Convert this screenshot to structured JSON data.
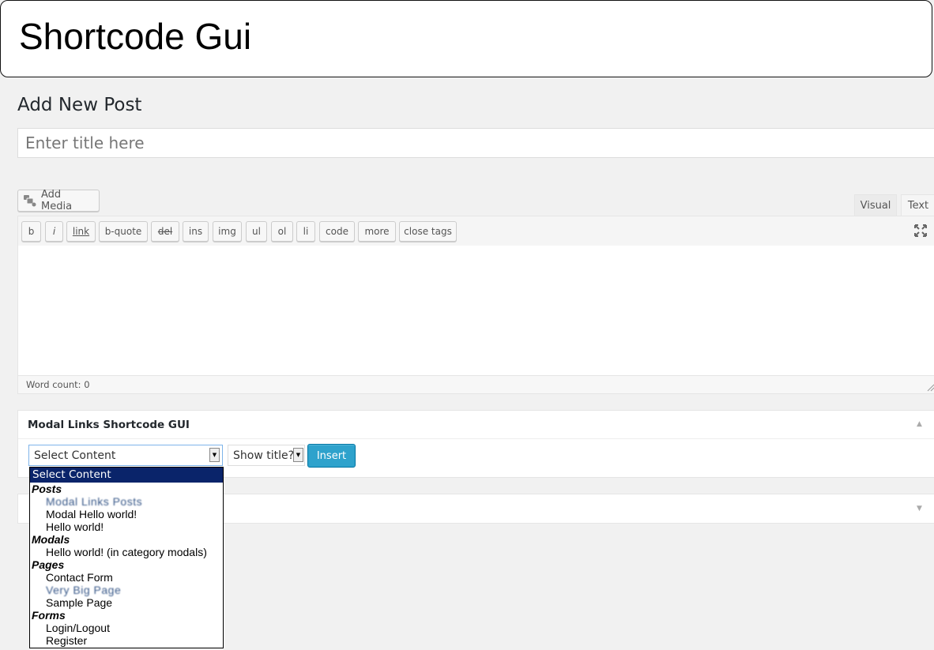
{
  "banner": {
    "title": "Shortcode Gui"
  },
  "page": {
    "heading": "Add New Post"
  },
  "title_field": {
    "placeholder": "Enter title here",
    "value": ""
  },
  "media": {
    "label": "Add Media",
    "icon": "add-media-icon"
  },
  "editor_tabs": [
    {
      "label": "Visual"
    },
    {
      "label": "Text"
    }
  ],
  "quicktags": [
    {
      "label": "b"
    },
    {
      "label": "i"
    },
    {
      "label": "link"
    },
    {
      "label": "b-quote"
    },
    {
      "label": "del"
    },
    {
      "label": "ins"
    },
    {
      "label": "img"
    },
    {
      "label": "ul"
    },
    {
      "label": "ol"
    },
    {
      "label": "li"
    },
    {
      "label": "code"
    },
    {
      "label": "more"
    },
    {
      "label": "close tags"
    }
  ],
  "editor": {
    "content": "",
    "word_count": "Word count: 0"
  },
  "modal_box": {
    "title": "Modal Links Shortcode GUI",
    "select_value": "Select Content",
    "show_title_value": "Show title?",
    "insert_label": "Insert"
  },
  "dropdown": {
    "selected": "Select Content",
    "groups": [
      {
        "label": "Posts",
        "options": [
          "Modal Links Posts",
          "Modal Hello world!",
          "Hello world!"
        ]
      },
      {
        "label": "Modals",
        "options": [
          "Hello world! (in category modals)"
        ]
      },
      {
        "label": "Pages",
        "options": [
          "Contact Form",
          "Very Big Page",
          "Sample Page"
        ]
      },
      {
        "label": "Forms",
        "options": [
          "Login/Logout",
          "Register"
        ]
      }
    ]
  },
  "colors": {
    "insert_button": "#2ea2cc",
    "dropdown_highlight": "#0a246a",
    "background": "#f1f1f1"
  }
}
